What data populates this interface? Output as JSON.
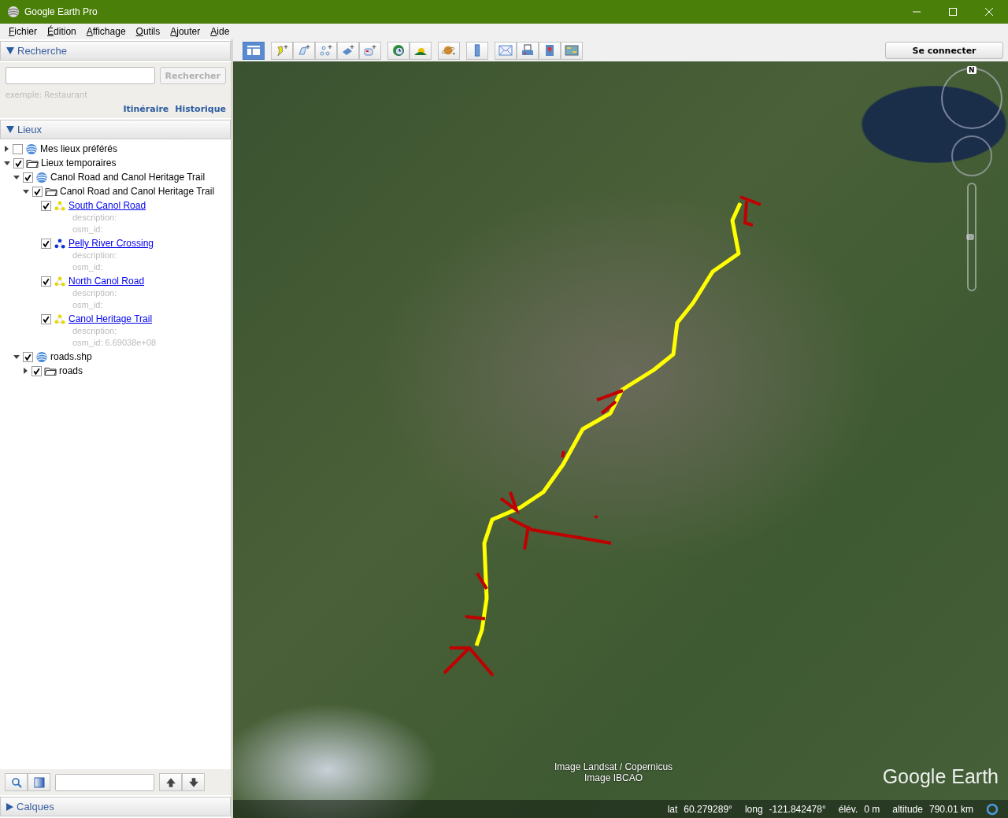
{
  "window": {
    "title": "Google Earth Pro"
  },
  "menu": [
    "Fichier",
    "Édition",
    "Affichage",
    "Outils",
    "Ajouter",
    "Aide"
  ],
  "search": {
    "title": "Recherche",
    "expanded": true,
    "button": "Rechercher",
    "button_disabled": true,
    "hint": "exemple: Restaurant",
    "links": [
      "Itinéraire",
      "Historique"
    ]
  },
  "places": {
    "title": "Lieux",
    "expanded": true,
    "tree": [
      {
        "label": "Mes lieux préférés",
        "kind": "document",
        "checked": false,
        "expanded": false
      },
      {
        "label": "Lieux temporaires",
        "kind": "folder",
        "checked": true,
        "expanded": true,
        "children": [
          {
            "label": "Canol Road and Canol Heritage Trail",
            "kind": "document",
            "checked": true,
            "expanded": true,
            "children": [
              {
                "label": "Canol Road and Canol Heritage Trail",
                "kind": "folder",
                "checked": true,
                "expanded": true,
                "children": [
                  {
                    "label": "South Canol Road",
                    "kind": "path",
                    "color": "#e8d800",
                    "checked": true,
                    "details": [
                      "description:",
                      "osm_id:"
                    ]
                  },
                  {
                    "label": "Pelly River Crossing",
                    "kind": "path",
                    "color": "#1030d0",
                    "checked": true,
                    "details": [
                      "description:",
                      "osm_id:"
                    ]
                  },
                  {
                    "label": "North Canol Road",
                    "kind": "path",
                    "color": "#e8d800",
                    "checked": true,
                    "details": [
                      "description:",
                      "osm_id:"
                    ]
                  },
                  {
                    "label": "Canol Heritage Trail",
                    "kind": "path",
                    "color": "#e8d800",
                    "checked": true,
                    "details": [
                      "description:",
                      "osm_id: 6.69038e+08"
                    ]
                  }
                ]
              }
            ]
          },
          {
            "label": "roads.shp",
            "kind": "document",
            "checked": true,
            "expanded": true,
            "children": [
              {
                "label": "roads",
                "kind": "folder",
                "checked": true,
                "expanded": false
              }
            ]
          }
        ]
      }
    ]
  },
  "layers": {
    "title": "Calques",
    "expanded": false
  },
  "toolbar": {
    "sign_in": "Se connecter"
  },
  "map": {
    "attribution": [
      "Image Landsat / Copernicus",
      "Image IBCAO"
    ],
    "logo": "Google Earth",
    "compass": "N",
    "zoom": {
      "level": 0.5
    },
    "status": [
      {
        "label": "lat",
        "value": "60.279289°"
      },
      {
        "label": "long",
        "value": "-121.842478°"
      },
      {
        "label": "élév.",
        "value": "0 m"
      },
      {
        "label": "altitude",
        "value": "790.01 km"
      }
    ]
  }
}
